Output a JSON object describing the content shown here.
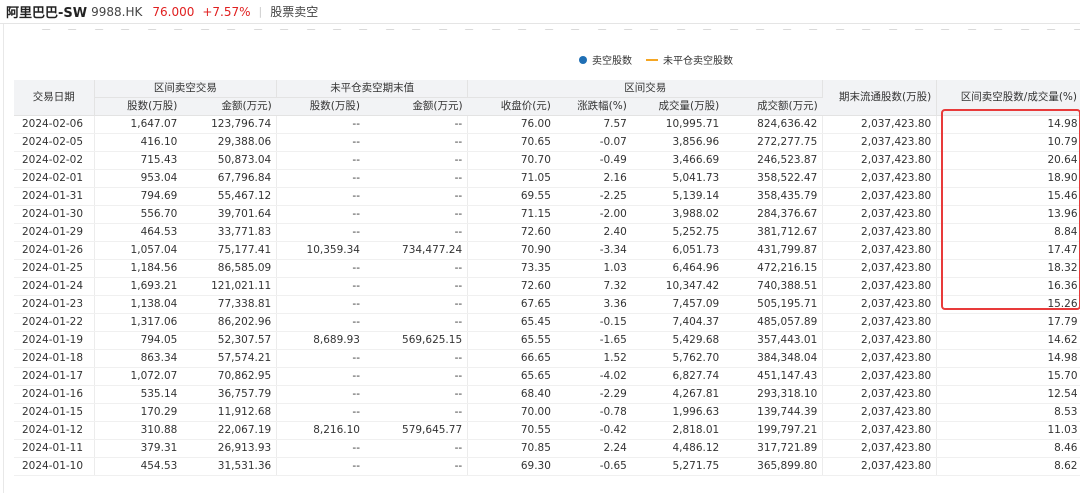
{
  "header": {
    "stock_name": "阿里巴巴-SW",
    "stock_code": "9988.HK",
    "price": "76.000",
    "change": "+7.57%",
    "tab": "股票卖空"
  },
  "legend": {
    "short_shares": "卖空股数",
    "open_short": "未平仓卖空股数"
  },
  "colors": {
    "up": "#e02020",
    "legend_dot": "#1f6fb5",
    "legend_line": "#f5a623",
    "highlight": "#e83a3a"
  },
  "table": {
    "group_headers": {
      "date": "交易日期",
      "short_trade": "区间卖空交易",
      "open_short": "未平仓卖空期末值",
      "trade": "区间交易",
      "float": "期末流通股数(万股)",
      "ratio": "区间卖空股数/成交量(%)"
    },
    "sub_headers": {
      "short_shares": "股数(万股)",
      "short_amount": "金额(万元)",
      "open_shares": "股数(万股)",
      "open_amount": "金额(万元)",
      "close": "收盘价(元)",
      "pct": "涨跌幅(%)",
      "volume": "成交量(万股)",
      "turnover": "成交额(万元)"
    },
    "rows": [
      [
        "2024-02-06",
        "1,647.07",
        "123,796.74",
        "--",
        "--",
        "76.00",
        "7.57",
        "10,995.71",
        "824,636.42",
        "2,037,423.80",
        "14.98"
      ],
      [
        "2024-02-05",
        "416.10",
        "29,388.06",
        "--",
        "--",
        "70.65",
        "-0.07",
        "3,856.96",
        "272,277.75",
        "2,037,423.80",
        "10.79"
      ],
      [
        "2024-02-02",
        "715.43",
        "50,873.04",
        "--",
        "--",
        "70.70",
        "-0.49",
        "3,466.69",
        "246,523.87",
        "2,037,423.80",
        "20.64"
      ],
      [
        "2024-02-01",
        "953.04",
        "67,796.84",
        "--",
        "--",
        "71.05",
        "2.16",
        "5,041.73",
        "358,522.47",
        "2,037,423.80",
        "18.90"
      ],
      [
        "2024-01-31",
        "794.69",
        "55,467.12",
        "--",
        "--",
        "69.55",
        "-2.25",
        "5,139.14",
        "358,435.79",
        "2,037,423.80",
        "15.46"
      ],
      [
        "2024-01-30",
        "556.70",
        "39,701.64",
        "--",
        "--",
        "71.15",
        "-2.00",
        "3,988.02",
        "284,376.67",
        "2,037,423.80",
        "13.96"
      ],
      [
        "2024-01-29",
        "464.53",
        "33,771.83",
        "--",
        "--",
        "72.60",
        "2.40",
        "5,252.75",
        "381,712.67",
        "2,037,423.80",
        "8.84"
      ],
      [
        "2024-01-26",
        "1,057.04",
        "75,177.41",
        "10,359.34",
        "734,477.24",
        "70.90",
        "-3.34",
        "6,051.73",
        "431,799.87",
        "2,037,423.80",
        "17.47"
      ],
      [
        "2024-01-25",
        "1,184.56",
        "86,585.09",
        "--",
        "--",
        "73.35",
        "1.03",
        "6,464.96",
        "472,216.15",
        "2,037,423.80",
        "18.32"
      ],
      [
        "2024-01-24",
        "1,693.21",
        "121,021.11",
        "--",
        "--",
        "72.60",
        "7.32",
        "10,347.42",
        "740,388.51",
        "2,037,423.80",
        "16.36"
      ],
      [
        "2024-01-23",
        "1,138.04",
        "77,338.81",
        "--",
        "--",
        "67.65",
        "3.36",
        "7,457.09",
        "505,195.71",
        "2,037,423.80",
        "15.26"
      ],
      [
        "2024-01-22",
        "1,317.06",
        "86,202.96",
        "--",
        "--",
        "65.45",
        "-0.15",
        "7,404.37",
        "485,057.89",
        "2,037,423.80",
        "17.79"
      ],
      [
        "2024-01-19",
        "794.05",
        "52,307.57",
        "8,689.93",
        "569,625.15",
        "65.55",
        "-1.65",
        "5,429.68",
        "357,443.01",
        "2,037,423.80",
        "14.62"
      ],
      [
        "2024-01-18",
        "863.34",
        "57,574.21",
        "--",
        "--",
        "66.65",
        "1.52",
        "5,762.70",
        "384,348.04",
        "2,037,423.80",
        "14.98"
      ],
      [
        "2024-01-17",
        "1,072.07",
        "70,862.95",
        "--",
        "--",
        "65.65",
        "-4.02",
        "6,827.74",
        "451,147.43",
        "2,037,423.80",
        "15.70"
      ],
      [
        "2024-01-16",
        "535.14",
        "36,757.79",
        "--",
        "--",
        "68.40",
        "-2.29",
        "4,267.81",
        "293,318.10",
        "2,037,423.80",
        "12.54"
      ],
      [
        "2024-01-15",
        "170.29",
        "11,912.68",
        "--",
        "--",
        "70.00",
        "-0.78",
        "1,996.63",
        "139,744.39",
        "2,037,423.80",
        "8.53"
      ],
      [
        "2024-01-12",
        "310.88",
        "22,067.19",
        "8,216.10",
        "579,645.77",
        "70.55",
        "-0.42",
        "2,818.01",
        "199,797.21",
        "2,037,423.80",
        "11.03"
      ],
      [
        "2024-01-11",
        "379.31",
        "26,913.93",
        "--",
        "--",
        "70.85",
        "2.24",
        "4,486.12",
        "317,721.89",
        "2,037,423.80",
        "8.46"
      ],
      [
        "2024-01-10",
        "454.53",
        "31,531.36",
        "--",
        "--",
        "69.30",
        "-0.65",
        "5,271.75",
        "365,899.80",
        "2,037,423.80",
        "8.62"
      ]
    ]
  }
}
